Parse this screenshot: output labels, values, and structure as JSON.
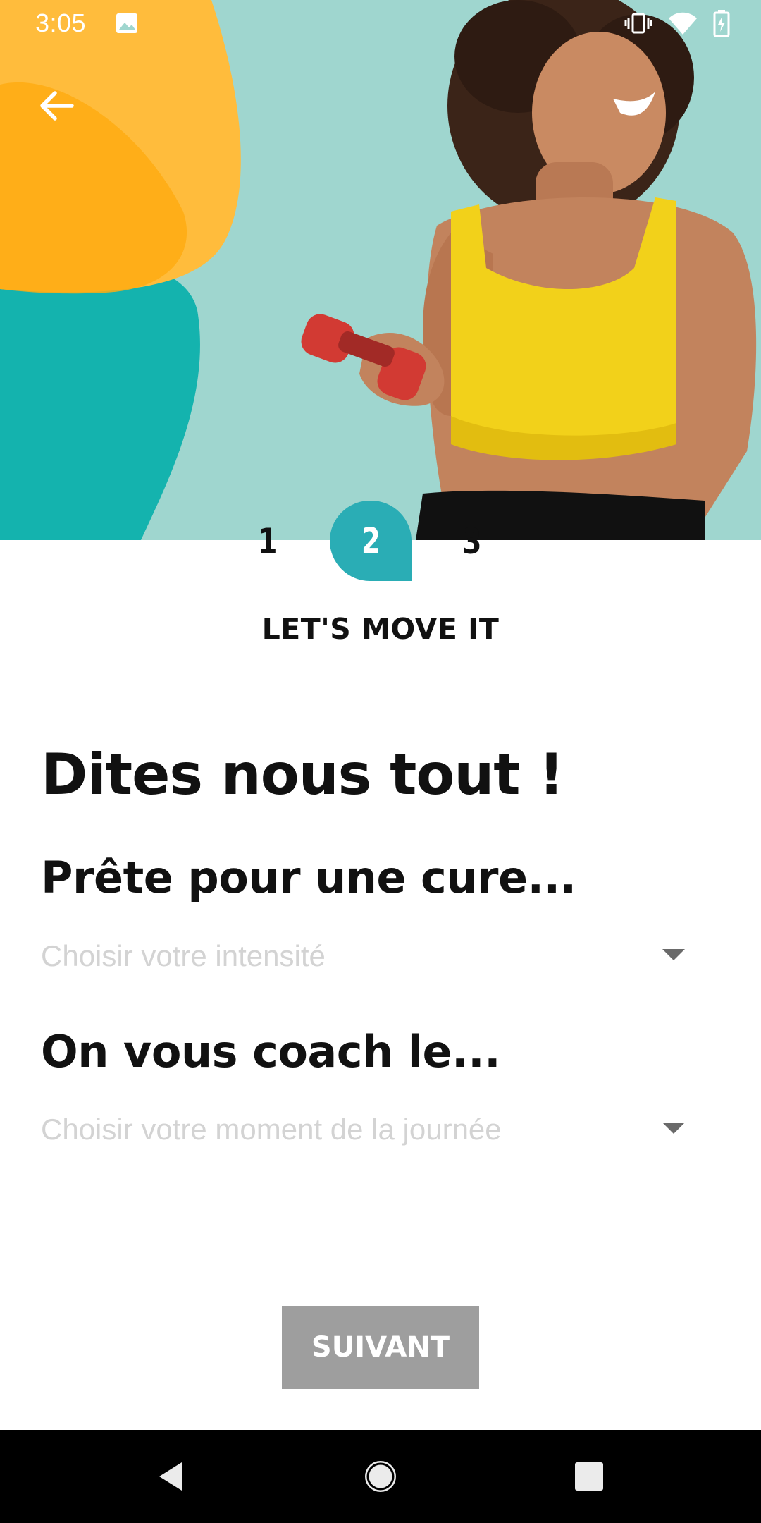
{
  "status_bar": {
    "time": "3:05",
    "icons": [
      "image-icon",
      "vibrate-icon",
      "wifi-icon",
      "battery-charging-icon"
    ]
  },
  "header": {
    "back_icon": "arrow-left-icon"
  },
  "stepper": {
    "steps": [
      "1",
      "2",
      "3"
    ],
    "active_index": 1,
    "active_color": "#2aadb5"
  },
  "brand_subtitle": "LET'S MOVE IT",
  "page_title": "Dites nous tout !",
  "sections": [
    {
      "title": "Prête pour une cure...",
      "placeholder": "Choisir votre intensité"
    },
    {
      "title": "On vous coach le...",
      "placeholder": "Choisir votre moment de la journée"
    }
  ],
  "next_button": {
    "label": "SUIVANT",
    "color": "#9e9e9e"
  },
  "nav_bar": {
    "icons": [
      "nav-back-icon",
      "nav-home-icon",
      "nav-recent-icon"
    ]
  },
  "colors": {
    "teal": "#2aadb5",
    "orange": "#ffb322",
    "background_mint": "#9fd6cf",
    "placeholder": "#d3d3d3"
  }
}
